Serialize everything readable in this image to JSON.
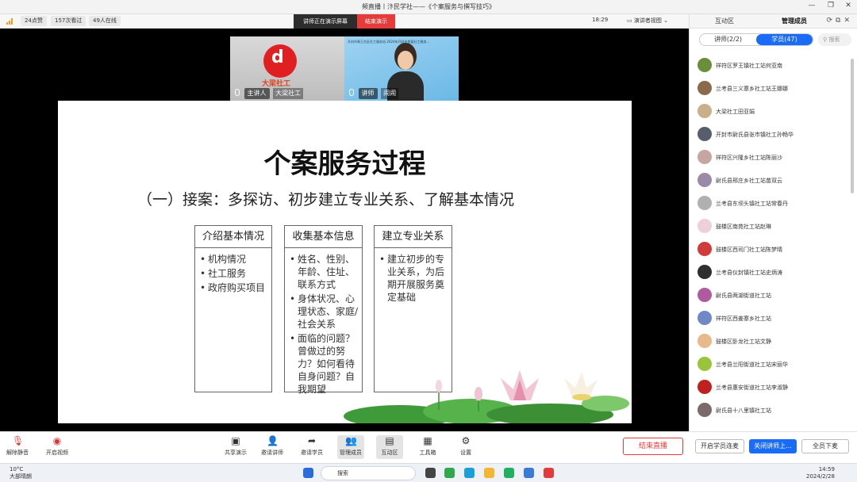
{
  "window": {
    "title": "频直播丨汴民学社——《个案服务与撰写技巧》"
  },
  "toolbar": {
    "likes": "24点赞",
    "watched": "157次看过",
    "online": "49人在线",
    "demo_status": "讲师正在演示屏幕",
    "end_demo": "结束演示",
    "clock": "18:29",
    "view_mode": "演讲者视图"
  },
  "tiles": [
    {
      "role": "主讲人",
      "name": "大梁社工",
      "logo_text": "大梁社工"
    },
    {
      "role": "讲师",
      "name": "闹闹",
      "banner": "开封市禹王台区社工服务站 2024年开封市首届社工服务..."
    }
  ],
  "slide": {
    "title": "个案服务过程",
    "subtitle": "（一）接案：多探访、初步建立专业关系、了解基本情况",
    "boxes": [
      {
        "head": "介绍基本情况",
        "items": [
          "机构情况",
          "社工服务",
          "政府购买项目"
        ]
      },
      {
        "head": "收集基本信息",
        "items": [
          "姓名、性别、年龄、住址、联系方式",
          "身体状况、心理状态、家庭/社会关系",
          "面临的问题？曾做过的努力？如何看待自身问题？自我期望"
        ]
      },
      {
        "head": "建立专业关系",
        "items": [
          "建立初步的专业关系，为后期开展服务奠定基础"
        ]
      }
    ]
  },
  "panel": {
    "tabs": [
      "互动区",
      "管理成员"
    ],
    "seg_teachers": "讲师(2/2)",
    "seg_students": "学员(47)",
    "search_placeholder": "搜索",
    "members": [
      {
        "name": "祥符区罗王镇社工站何亚南",
        "color": "#6b8e3a"
      },
      {
        "name": "兰考县三义寨乡社工站王娜娜",
        "color": "#8a6a4a"
      },
      {
        "name": "大梁社工田亚娟",
        "color": "#c9b08a"
      },
      {
        "name": "开封市尉氏县张市镇社工孙畅华",
        "color": "#555e6a"
      },
      {
        "name": "祥符区兴隆乡社工站陈丽沙",
        "color": "#c7a5a0"
      },
      {
        "name": "尉氏县邢庄乡社工站苗双云",
        "color": "#9a8aa8"
      },
      {
        "name": "兰考县东坝头镇社工站常春丹",
        "color": "#b0b0b0"
      },
      {
        "name": "鼓楼区南苑社工站赵琳",
        "color": "#f0d0d8"
      },
      {
        "name": "鼓楼区西司门社工站陈梦晴",
        "color": "#d23b3b"
      },
      {
        "name": "兰考县仪封镇社工站史炳涛",
        "color": "#2f2f2f"
      },
      {
        "name": "尉氏县两湖街道社工站",
        "color": "#b05aa0"
      },
      {
        "name": "祥符区西姜寨乡社工站",
        "color": "#6f88c6"
      },
      {
        "name": "鼓楼区卧龙社工站文静",
        "color": "#e8b98a"
      },
      {
        "name": "兰考县兰阳街道社工站宋丽华",
        "color": "#9ac43a"
      },
      {
        "name": "兰考县惠安街道社工站李淑静",
        "color": "#c02020"
      },
      {
        "name": "尉氏县十八里镇社工站",
        "color": "#7a6a6a"
      }
    ]
  },
  "bottom": {
    "mute": "解除静音",
    "camera": "开启视频",
    "tools": [
      "共享演示",
      "邀请讲师",
      "邀请学员",
      "管理成员",
      "互动区",
      "工具箱",
      "设置"
    ],
    "end_live": "结束直播",
    "enable_connect": "开启学员连麦",
    "close_teacher": "关闭讲师上...",
    "mute_all": "全员下麦"
  },
  "taskbar": {
    "temp": "10°C",
    "weather": "大部晴朗",
    "search": "搜索",
    "time": "14:59",
    "date": "2024/2/28"
  }
}
